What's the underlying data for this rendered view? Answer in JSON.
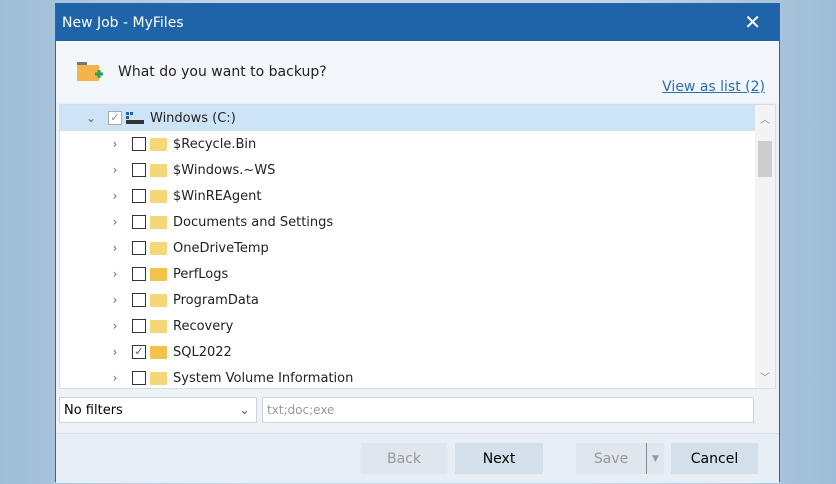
{
  "window": {
    "title": "New Job - MyFiles",
    "close": "✕"
  },
  "header": {
    "question": "What do you want to backup?",
    "view_link": "View as list (2)"
  },
  "tree": {
    "root": {
      "label": "Windows (C:)",
      "checked": true
    },
    "items": [
      {
        "label": "$Recycle.Bin",
        "checked": false
      },
      {
        "label": "$Windows.~WS",
        "checked": false
      },
      {
        "label": "$WinREAgent",
        "checked": false
      },
      {
        "label": "Documents and Settings",
        "checked": false
      },
      {
        "label": "OneDriveTemp",
        "checked": false
      },
      {
        "label": "PerfLogs",
        "checked": false
      },
      {
        "label": "ProgramData",
        "checked": false
      },
      {
        "label": "Recovery",
        "checked": false
      },
      {
        "label": "SQL2022",
        "checked": true
      },
      {
        "label": "System Volume Information",
        "checked": false
      }
    ]
  },
  "filters": {
    "selected": "No filters",
    "placeholder": "txt;doc;exe"
  },
  "footer": {
    "back": "Back",
    "next": "Next",
    "save": "Save",
    "cancel": "Cancel"
  }
}
